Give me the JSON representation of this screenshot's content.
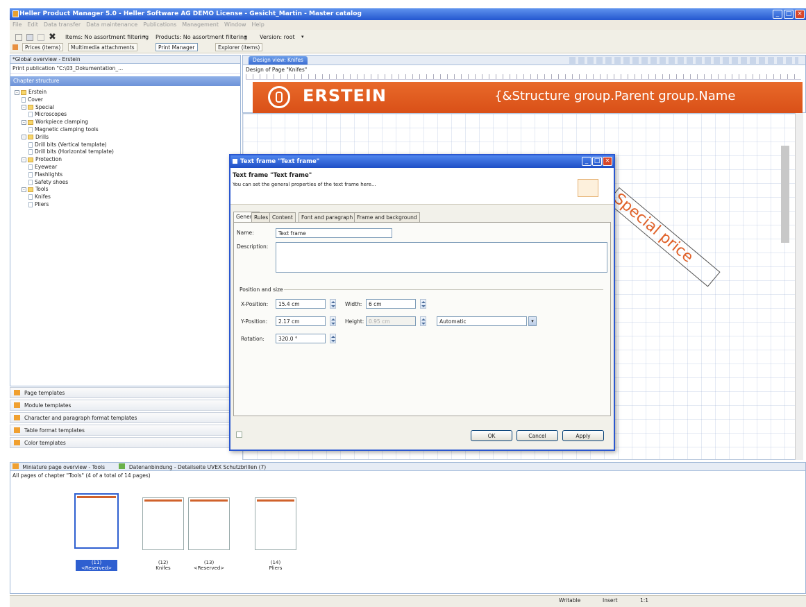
{
  "window": {
    "title": "Heller Product Manager 5.0 - Heller Software AG DEMO License - Gesicht_Martin - Master catalog"
  },
  "menu": [
    "File",
    "Edit",
    "Data transfer",
    "Data maintenance",
    "Publications",
    "Management",
    "Window",
    "Help"
  ],
  "toolbar": {
    "items_filter": "Items: No assortment filtering",
    "products_filter": "Products: No assortment filtering",
    "version": "Version: root",
    "tabs": [
      "Prices (items)",
      "Multimedia attachments",
      "Print Manager",
      "Explorer (items)"
    ]
  },
  "left_panel": {
    "title": "*Global overview - Erstein",
    "print_publication": "Print publication \"C:\\03_Dokumentation_...",
    "section_title": "Chapter structure",
    "tree": [
      {
        "label": "Erstein",
        "level": 0,
        "type": "folder",
        "toggle": "-"
      },
      {
        "label": "Cover",
        "level": 1,
        "type": "page",
        "toggle": ""
      },
      {
        "label": "Special",
        "level": 1,
        "type": "folder",
        "toggle": "-"
      },
      {
        "label": "Microscopes",
        "level": 2,
        "type": "page",
        "toggle": ""
      },
      {
        "label": "Workpiece clamping",
        "level": 1,
        "type": "folder",
        "toggle": "-"
      },
      {
        "label": "Magnetic clamping tools",
        "level": 2,
        "type": "page",
        "toggle": ""
      },
      {
        "label": "Drills",
        "level": 1,
        "type": "folder",
        "toggle": "-"
      },
      {
        "label": "Drill bits (Vertical template)",
        "level": 2,
        "type": "page",
        "toggle": ""
      },
      {
        "label": "Drill bits (Horizontal template)",
        "level": 2,
        "type": "page",
        "toggle": ""
      },
      {
        "label": "Protection",
        "level": 1,
        "type": "folder",
        "toggle": "-"
      },
      {
        "label": "Eyewear",
        "level": 2,
        "type": "page",
        "toggle": ""
      },
      {
        "label": "Flashlights",
        "level": 2,
        "type": "page",
        "toggle": ""
      },
      {
        "label": "Safety shoes",
        "level": 2,
        "type": "page",
        "toggle": ""
      },
      {
        "label": "Tools",
        "level": 1,
        "type": "folder",
        "toggle": "-"
      },
      {
        "label": "Knifes",
        "level": 2,
        "type": "page",
        "toggle": ""
      },
      {
        "label": "Pliers",
        "level": 2,
        "type": "page",
        "toggle": ""
      }
    ],
    "sections": [
      "Page templates",
      "Module templates",
      "Character and paragraph format templates",
      "Table format templates",
      "Color templates"
    ]
  },
  "editor": {
    "tab_label": "Design view: Knifes",
    "page_label": "Design of Page \"Knifes\"",
    "brand": "ERSTEIN",
    "header_placeholder": "{&Structure group.Parent group.Name",
    "special_price": "Special price"
  },
  "dialog": {
    "title": "Text frame \"Text frame\"",
    "heading": "Text frame \"Text frame\"",
    "description": "You can set the general properties of the text frame here...",
    "tabs": [
      "General",
      "Rules",
      "Content",
      "Font and paragraph",
      "Frame and background"
    ],
    "name_label": "Name:",
    "name_value": "Text frame",
    "description_label": "Description:",
    "position_group": "Position and size",
    "x_label": "X-Position:",
    "x_value": "15.4 cm",
    "width_label": "Width:",
    "width_value": "6 cm",
    "y_label": "Y-Position:",
    "y_value": "2.17 cm",
    "height_label": "Height:",
    "height_value": "0.95 cm",
    "height_mode": "Automatic",
    "rotation_label": "Rotation:",
    "rotation_value": "320.0 °",
    "ok": "OK",
    "cancel": "Cancel",
    "apply": "Apply"
  },
  "bottom_panel": {
    "tab1": "Miniature page overview - Tools",
    "tab2": "Datenanbindung - Detailseite UVEX Schutzbrillen (7)",
    "subtitle": "All pages of chapter \"Tools\" (4 of a total of 14 pages)",
    "thumbs": [
      {
        "num": "(11)",
        "name": "<Reserved>",
        "selected": true
      },
      {
        "num": "(12)",
        "name": "Knifes",
        "selected": false
      },
      {
        "num": "(13)",
        "name": "<Reserved>",
        "selected": false
      },
      {
        "num": "(14)",
        "name": "Pliers",
        "selected": false
      }
    ]
  },
  "status": {
    "writable": "Writable",
    "insert": "Insert",
    "pos": "1:1"
  },
  "colors": {
    "accent": "#d9531e",
    "title_blue": "#2457cf",
    "special_price": "#e0622a"
  }
}
